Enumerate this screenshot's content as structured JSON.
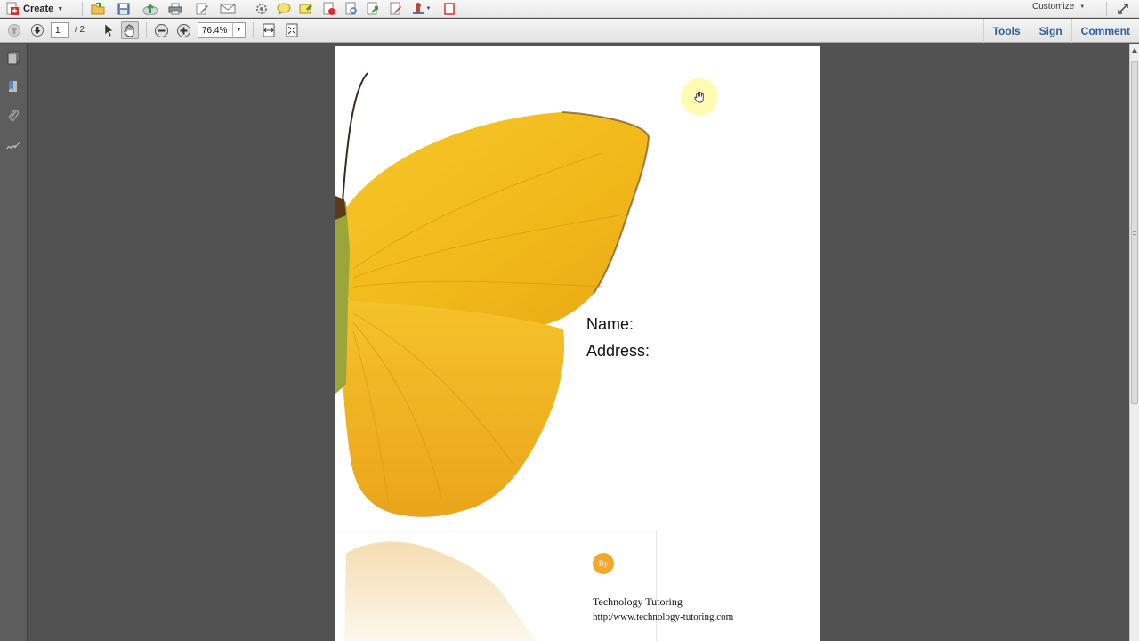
{
  "toolbar": {
    "create_label": "Create",
    "customize_label": "Customize",
    "page_current": "1",
    "page_total": "/ 2",
    "zoom_value": "76.4%"
  },
  "right_links": [
    "Tools",
    "Sign",
    "Comment"
  ],
  "document": {
    "name_label": "Name:",
    "address_label": "Address:",
    "by_label": "By",
    "company": "Technology Tutoring",
    "website": "http:/www.technology-tutoring.com"
  },
  "colors": {
    "accent_orange": "#f3a72b",
    "butterfly_yellow": "#f2bb1a",
    "link_blue": "#30609a",
    "workspace_gray": "#525252"
  },
  "icons": [
    "create-icon",
    "open-icon",
    "save-icon",
    "upload-icon",
    "print-icon",
    "edit-icon",
    "email-icon",
    "settings-icon",
    "comment-icon",
    "sticky-note-icon",
    "redact-icon",
    "document-icon",
    "export-icon",
    "sign-icon",
    "stamp-icon",
    "crop-icon"
  ]
}
